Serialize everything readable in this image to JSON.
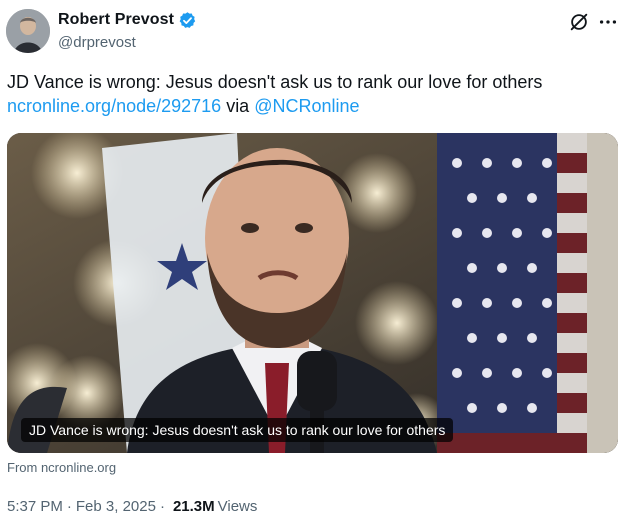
{
  "author": {
    "display_name": "Robert Prevost",
    "handle": "@drprevost",
    "verified_icon": "verified-badge-icon",
    "accent_color": "#1d9bf0"
  },
  "tweet": {
    "text": "JD Vance is wrong: Jesus doesn't ask us to rank our love for others",
    "link_text": "ncronline.org/node/292716",
    "via_text": "via",
    "mention": "@NCRonline"
  },
  "card": {
    "caption": "JD Vance is wrong: Jesus doesn't ask us to rank our love for others",
    "source_label": "From ncronline.org"
  },
  "meta": {
    "time": "5:37 PM",
    "separator": "·",
    "date": "Feb 3, 2025",
    "views_count": "21.3M",
    "views_label": "Views"
  },
  "actions": {
    "grok_icon": "grok-icon",
    "more_icon": "more-options-icon"
  }
}
